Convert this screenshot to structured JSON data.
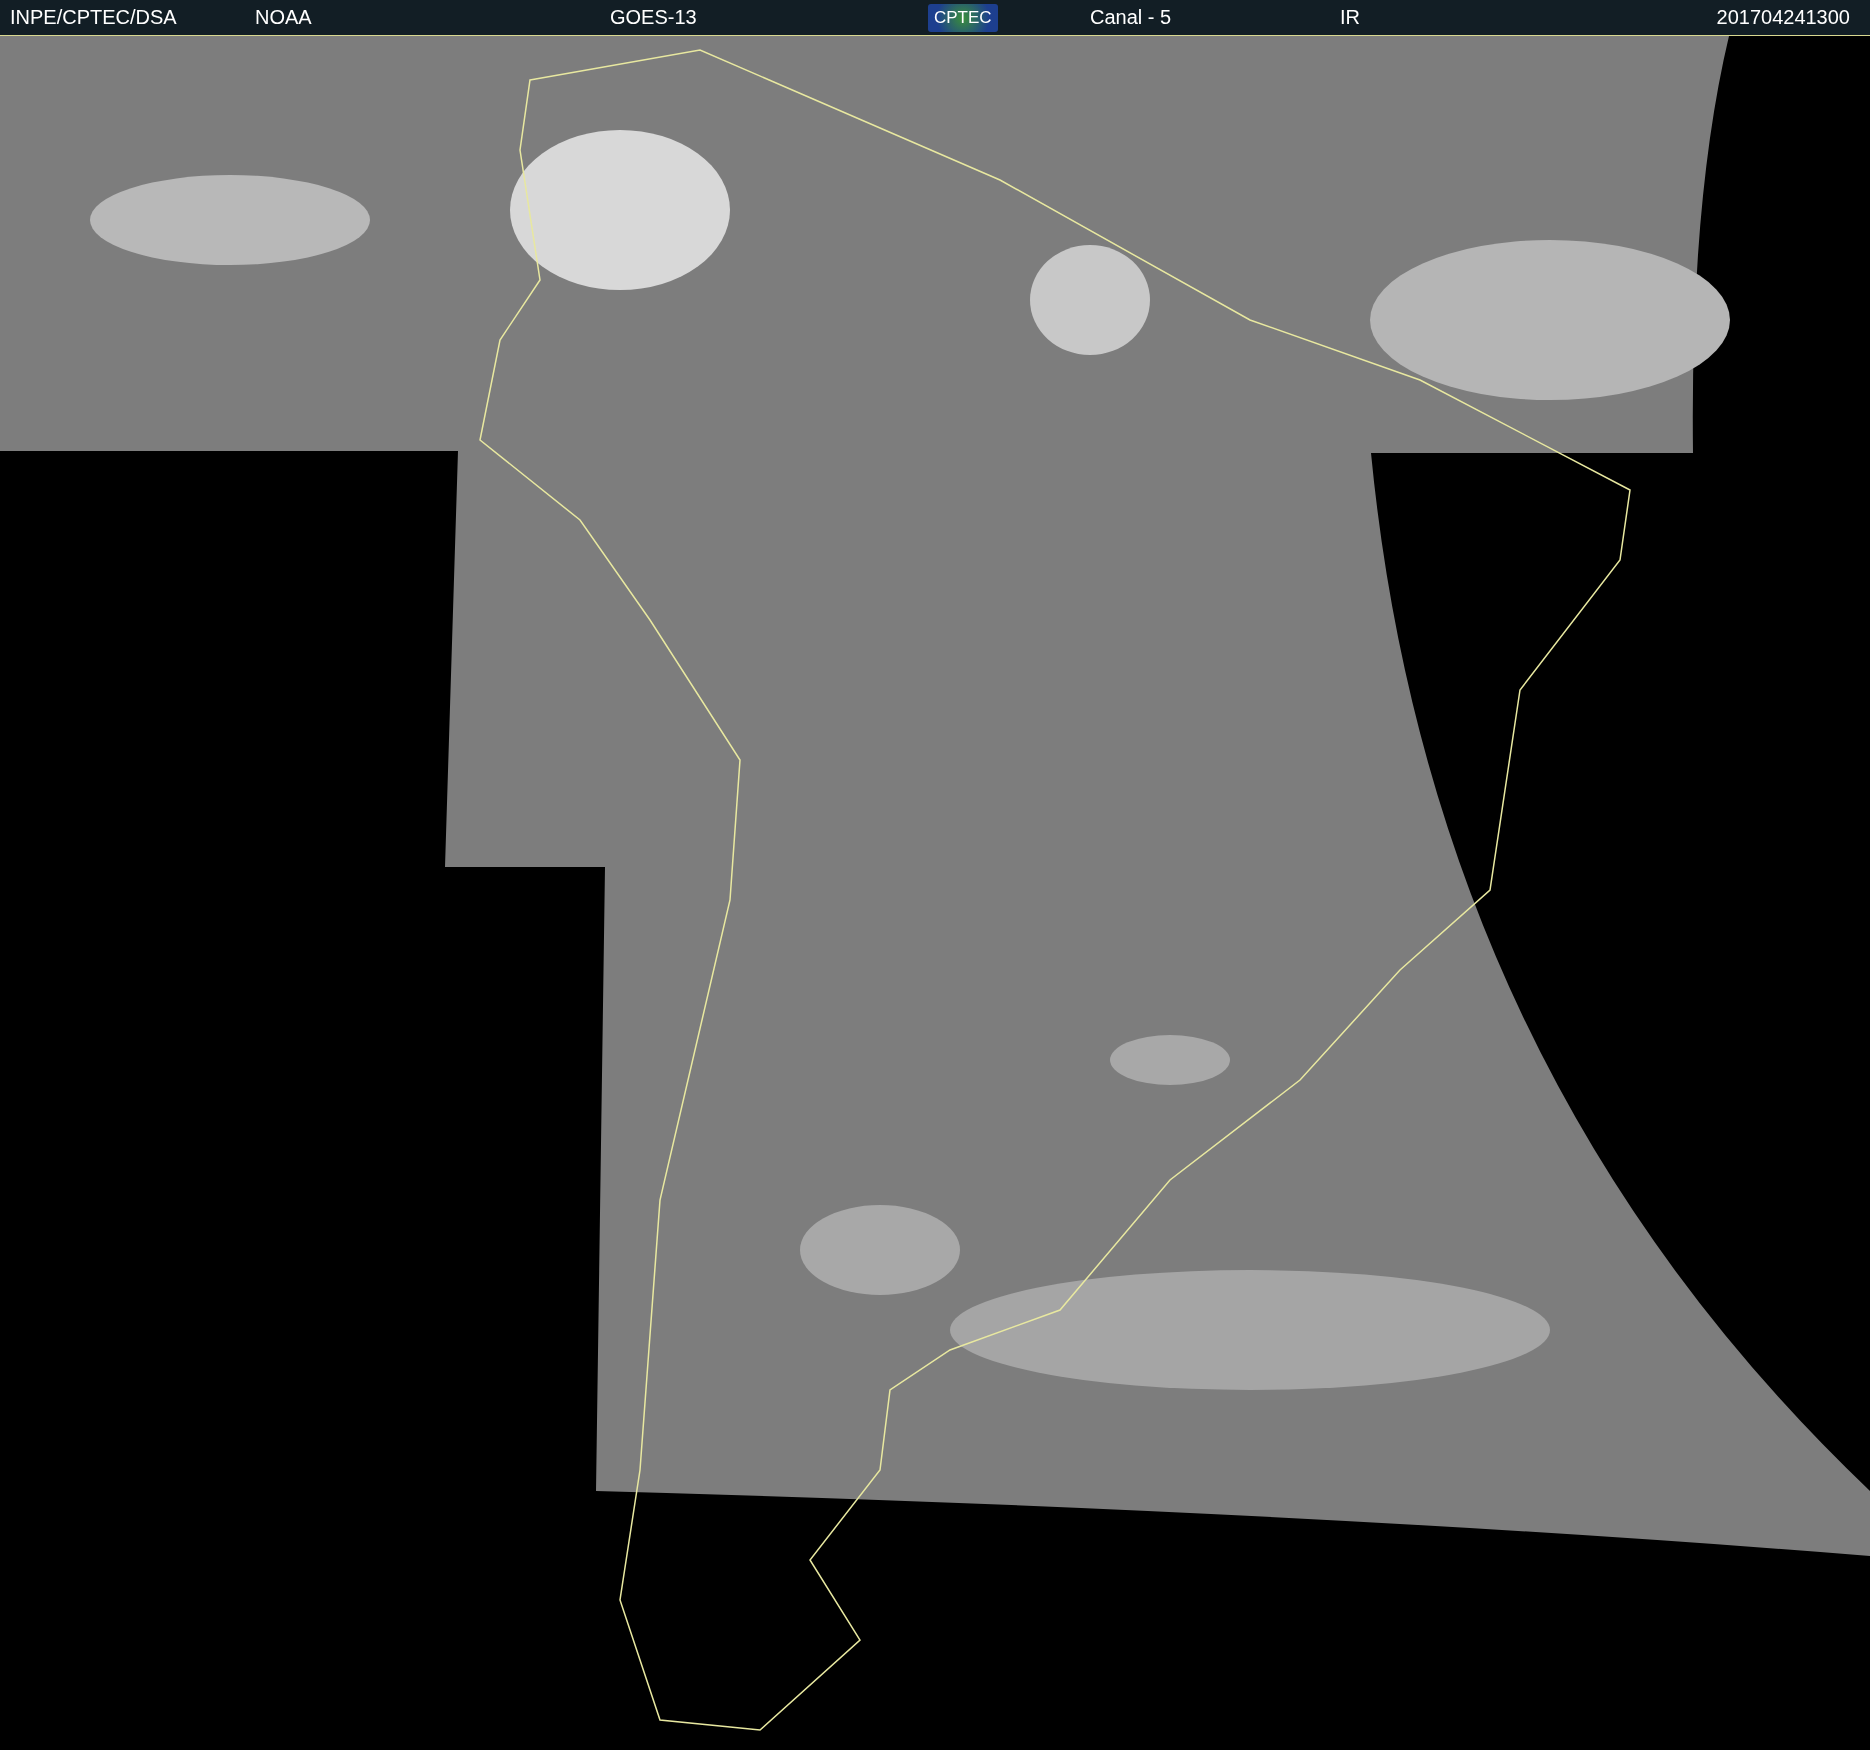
{
  "header": {
    "items": [
      {
        "kind": "text",
        "text": "INPE/CPTEC/DSA"
      },
      {
        "kind": "text",
        "text": "NOAA"
      },
      {
        "kind": "text",
        "text": "GOES-13"
      },
      {
        "kind": "logo",
        "text": "CPTEC"
      },
      {
        "kind": "text",
        "text": "Canal - 5"
      },
      {
        "kind": "text",
        "text": "IR"
      },
      {
        "kind": "text",
        "text": "201704241300"
      }
    ]
  }
}
